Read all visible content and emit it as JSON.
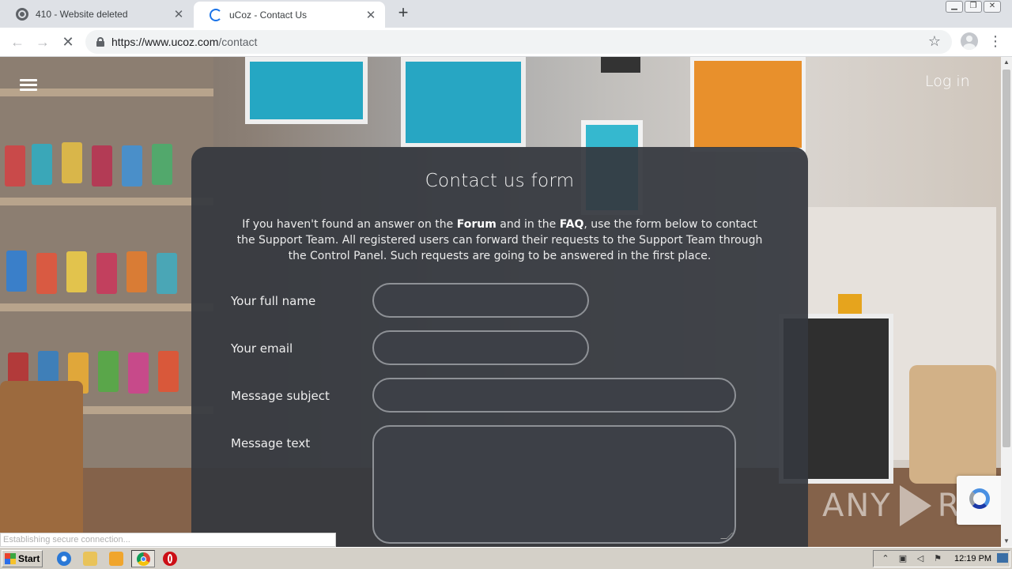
{
  "browser": {
    "tabs": [
      {
        "title": "410 - Website deleted",
        "icon": "globe-icon"
      },
      {
        "title": "uCoz - Contact Us",
        "icon": "loading-spinner-icon"
      }
    ],
    "new_tab_symbol": "+",
    "close_symbol": "✕",
    "url_host": "https://www.ucoz.com",
    "url_path": "/contact",
    "status_text": "Establishing secure connection..."
  },
  "page": {
    "login_label": "Log in",
    "form": {
      "title": "Contact us form",
      "intro_before_forum": "If you haven't found an answer on the ",
      "forum_link": "Forum",
      "intro_between": " and in the ",
      "faq_link": "FAQ",
      "intro_after": ", use the form below to contact the Support Team. All registered users can forward their requests to the Support Team through the Control Panel. Such requests are going to be answered in the first place.",
      "fields": {
        "full_name_label": "Your full name",
        "email_label": "Your email",
        "subject_label": "Message subject",
        "message_label": "Message text",
        "full_name_value": "",
        "email_value": "",
        "subject_value": "",
        "message_value": ""
      }
    },
    "watermark": {
      "left": "ANY",
      "right": "RUN"
    }
  },
  "taskbar": {
    "start_label": "Start",
    "clock": "12:19 PM"
  },
  "colors": {
    "card_bg": "#35383e",
    "input_border": "#8e9196",
    "chrome_tab_active": "#ffffff",
    "chrome_tabstrip": "#dee1e6"
  }
}
